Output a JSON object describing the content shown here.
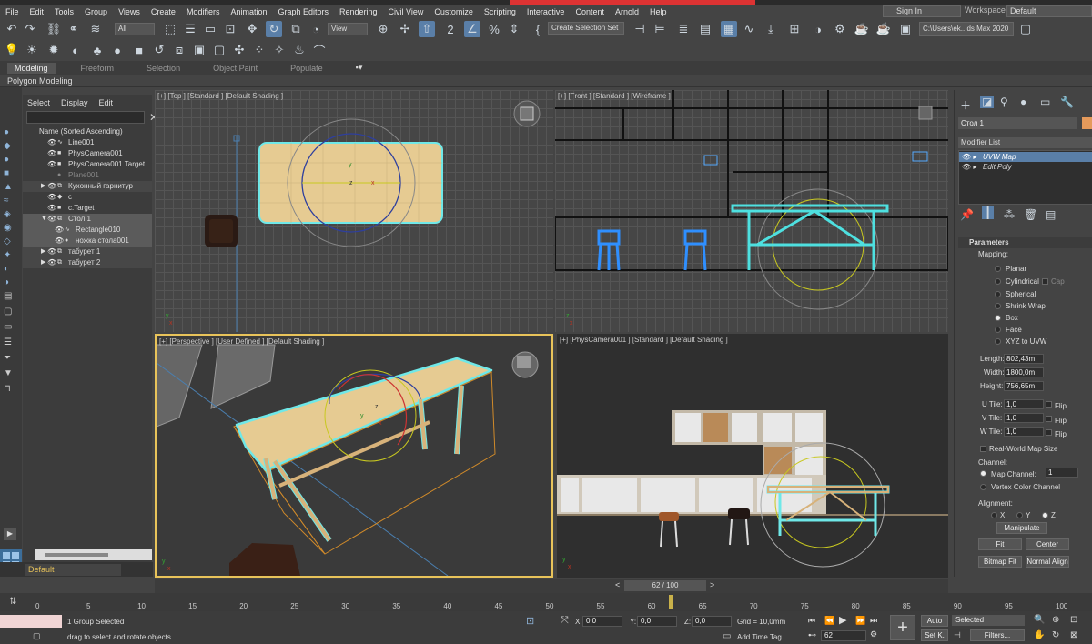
{
  "menubar": {
    "items": [
      "File",
      "Edit",
      "Tools",
      "Group",
      "Views",
      "Create",
      "Modifiers",
      "Animation",
      "Graph Editors",
      "Rendering",
      "Civil View",
      "Customize",
      "Scripting",
      "Interactive",
      "Content",
      "Arnold",
      "Help"
    ],
    "signin": "Sign In",
    "workspaces_label": "Workspaces:",
    "workspace_value": "Default"
  },
  "toolbar": {
    "filter_value": "All",
    "refcoord_value": "View",
    "selection_set_placeholder": "Create Selection Set",
    "project_path": "C:\\Users\\ek...ds Max 2020"
  },
  "ribbon": {
    "tabs": [
      "Modeling",
      "Freeform",
      "Selection",
      "Object Paint",
      "Populate"
    ],
    "sub_label": "Polygon Modeling"
  },
  "scene_explorer": {
    "menu": [
      "Select",
      "Display",
      "Edit"
    ],
    "header": "Name (Sorted Ascending)",
    "rows": [
      "Line001",
      "PhysCamera001",
      "PhysCamera001.Target",
      "Plane001",
      "Кухонный гарнитур",
      "c",
      "c.Target",
      "Стол 1",
      "Rectangle010",
      "ножка стола001",
      "табурет 1",
      "табурет 2"
    ]
  },
  "layer": {
    "default": "Default"
  },
  "viewports": {
    "top": "[+] [Top ] [Standard ] [Default Shading ]",
    "front": "[+] [Front ] [Standard ] [Wireframe ]",
    "persp": "[+] [Perspective ] [User Defined ] [Default Shading ]",
    "camera": "[+] [PhysCamera001 ] [Standard ] [Default Shading ]"
  },
  "command_panel": {
    "object_name": "Стол 1",
    "object_color": "#e59a5b",
    "modifier_list_label": "Modifier List",
    "modifiers": [
      "UVW Map",
      "Edit Poly"
    ],
    "parameters_title": "Parameters",
    "mapping_label": "Mapping:",
    "mapping_options": [
      "Planar",
      "Cylindrical",
      "Spherical",
      "Shrink Wrap",
      "Box",
      "Face",
      "XYZ to UVW"
    ],
    "mapping_selected": "Box",
    "cap_label": "Cap",
    "length_label": "Length:",
    "length_value": "802,43m",
    "width_label": "Width:",
    "width_value": "1800,0m",
    "height_label": "Height:",
    "height_value": "756,65m",
    "utile_label": "U Tile:",
    "utile_value": "1,0",
    "vtile_label": "V Tile:",
    "vtile_value": "1,0",
    "wtile_label": "W Tile:",
    "wtile_value": "1,0",
    "flip_label": "Flip",
    "realworld_label": "Real-World Map Size",
    "channel_label": "Channel:",
    "map_channel_label": "Map Channel:",
    "map_channel_value": "1",
    "vertex_color_label": "Vertex Color Channel",
    "alignment_label": "Alignment:",
    "axes": [
      "X",
      "Y",
      "Z"
    ],
    "axis_selected": "Z",
    "manipulate_label": "Manipulate",
    "fit_label": "Fit",
    "center_label": "Center",
    "bitmap_fit_label": "Bitmap Fit",
    "normal_align_label": "Normal Align"
  },
  "timeline": {
    "frame_counter": "62 / 100",
    "ticks": [
      "0",
      "5",
      "10",
      "15",
      "20",
      "25",
      "30",
      "35",
      "40",
      "45",
      "50",
      "55",
      "60",
      "65",
      "70",
      "75",
      "80",
      "85",
      "90",
      "95",
      "100"
    ],
    "current_frame": 62,
    "total_frames": 100
  },
  "status": {
    "selected_text": "1 Group Selected",
    "prompt_text": "drag to select and rotate objects",
    "x_label": "X:",
    "x_value": "0,0",
    "y_label": "Y:",
    "y_value": "0,0",
    "z_label": "Z:",
    "z_value": "0,0",
    "grid_text": "Grid = 10,0mm",
    "add_time_tag": "Add Time Tag",
    "frame_value": "62",
    "auto_label": "Auto",
    "setk_label": "Set K.",
    "selected_dropdown": "Selected",
    "filters_label": "Filters..."
  }
}
